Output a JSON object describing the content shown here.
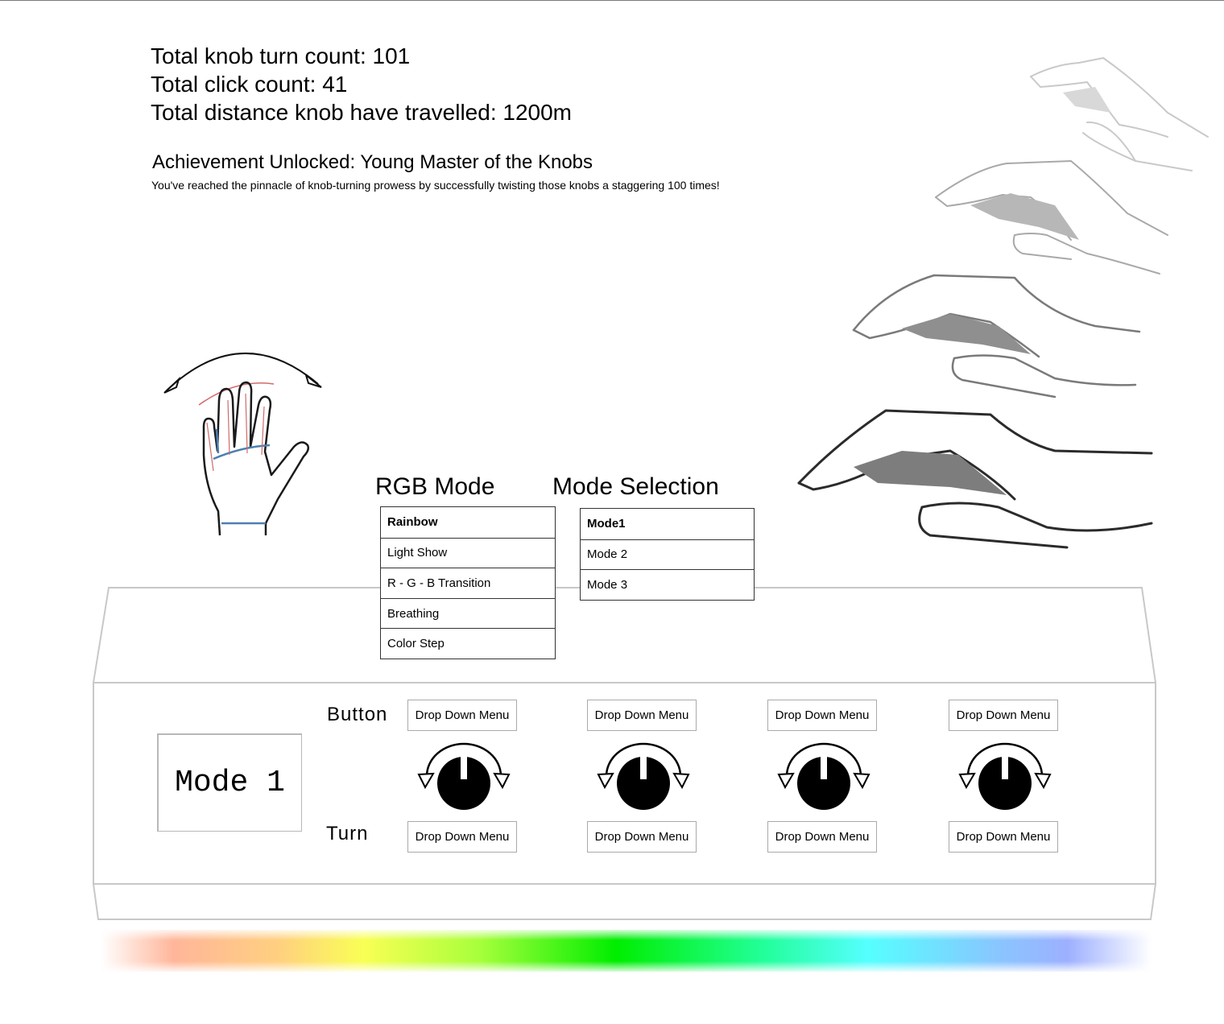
{
  "stats": {
    "knob_turn_count": "Total knob turn count: 101",
    "click_count": "Total click count: 41",
    "distance": "Total distance knob have travelled: 1200m"
  },
  "achievement": {
    "title": "Achievement Unlocked: Young Master of the Knobs",
    "description": "You've reached the pinnacle of knob-turning prowess by successfully twisting those knobs a staggering 100 times!"
  },
  "rgb_mode": {
    "title": "RGB Mode",
    "options": [
      "Rainbow",
      "Light Show",
      "R - G - B Transition",
      "Breathing",
      "Color Step"
    ],
    "selected": "Rainbow"
  },
  "mode_selection": {
    "title": "Mode Selection",
    "options": [
      "Mode1",
      "Mode 2",
      "Mode 3"
    ],
    "selected": "Mode1"
  },
  "device": {
    "display_text": "Mode 1",
    "button_label": "Button",
    "turn_label": "Turn",
    "knobs": [
      {
        "button_menu": "Drop Down Menu",
        "turn_menu": "Drop Down Menu"
      },
      {
        "button_menu": "Drop Down Menu",
        "turn_menu": "Drop Down Menu"
      },
      {
        "button_menu": "Drop Down Menu",
        "turn_menu": "Drop Down Menu"
      },
      {
        "button_menu": "Drop Down Menu",
        "turn_menu": "Drop Down Menu"
      }
    ]
  },
  "colors": {
    "knob": "#000000",
    "outline": "#c8c8c8",
    "light_bar": [
      "#ffb69a",
      "#ffd080",
      "#f9ff55",
      "#a8ff3b",
      "#00ee00",
      "#22ff99",
      "#55ffff",
      "#88c7ff",
      "#9db0ff"
    ]
  },
  "icons": [
    "wave-hand-icon",
    "typing-hands-icon",
    "knob-rotate-icon"
  ]
}
